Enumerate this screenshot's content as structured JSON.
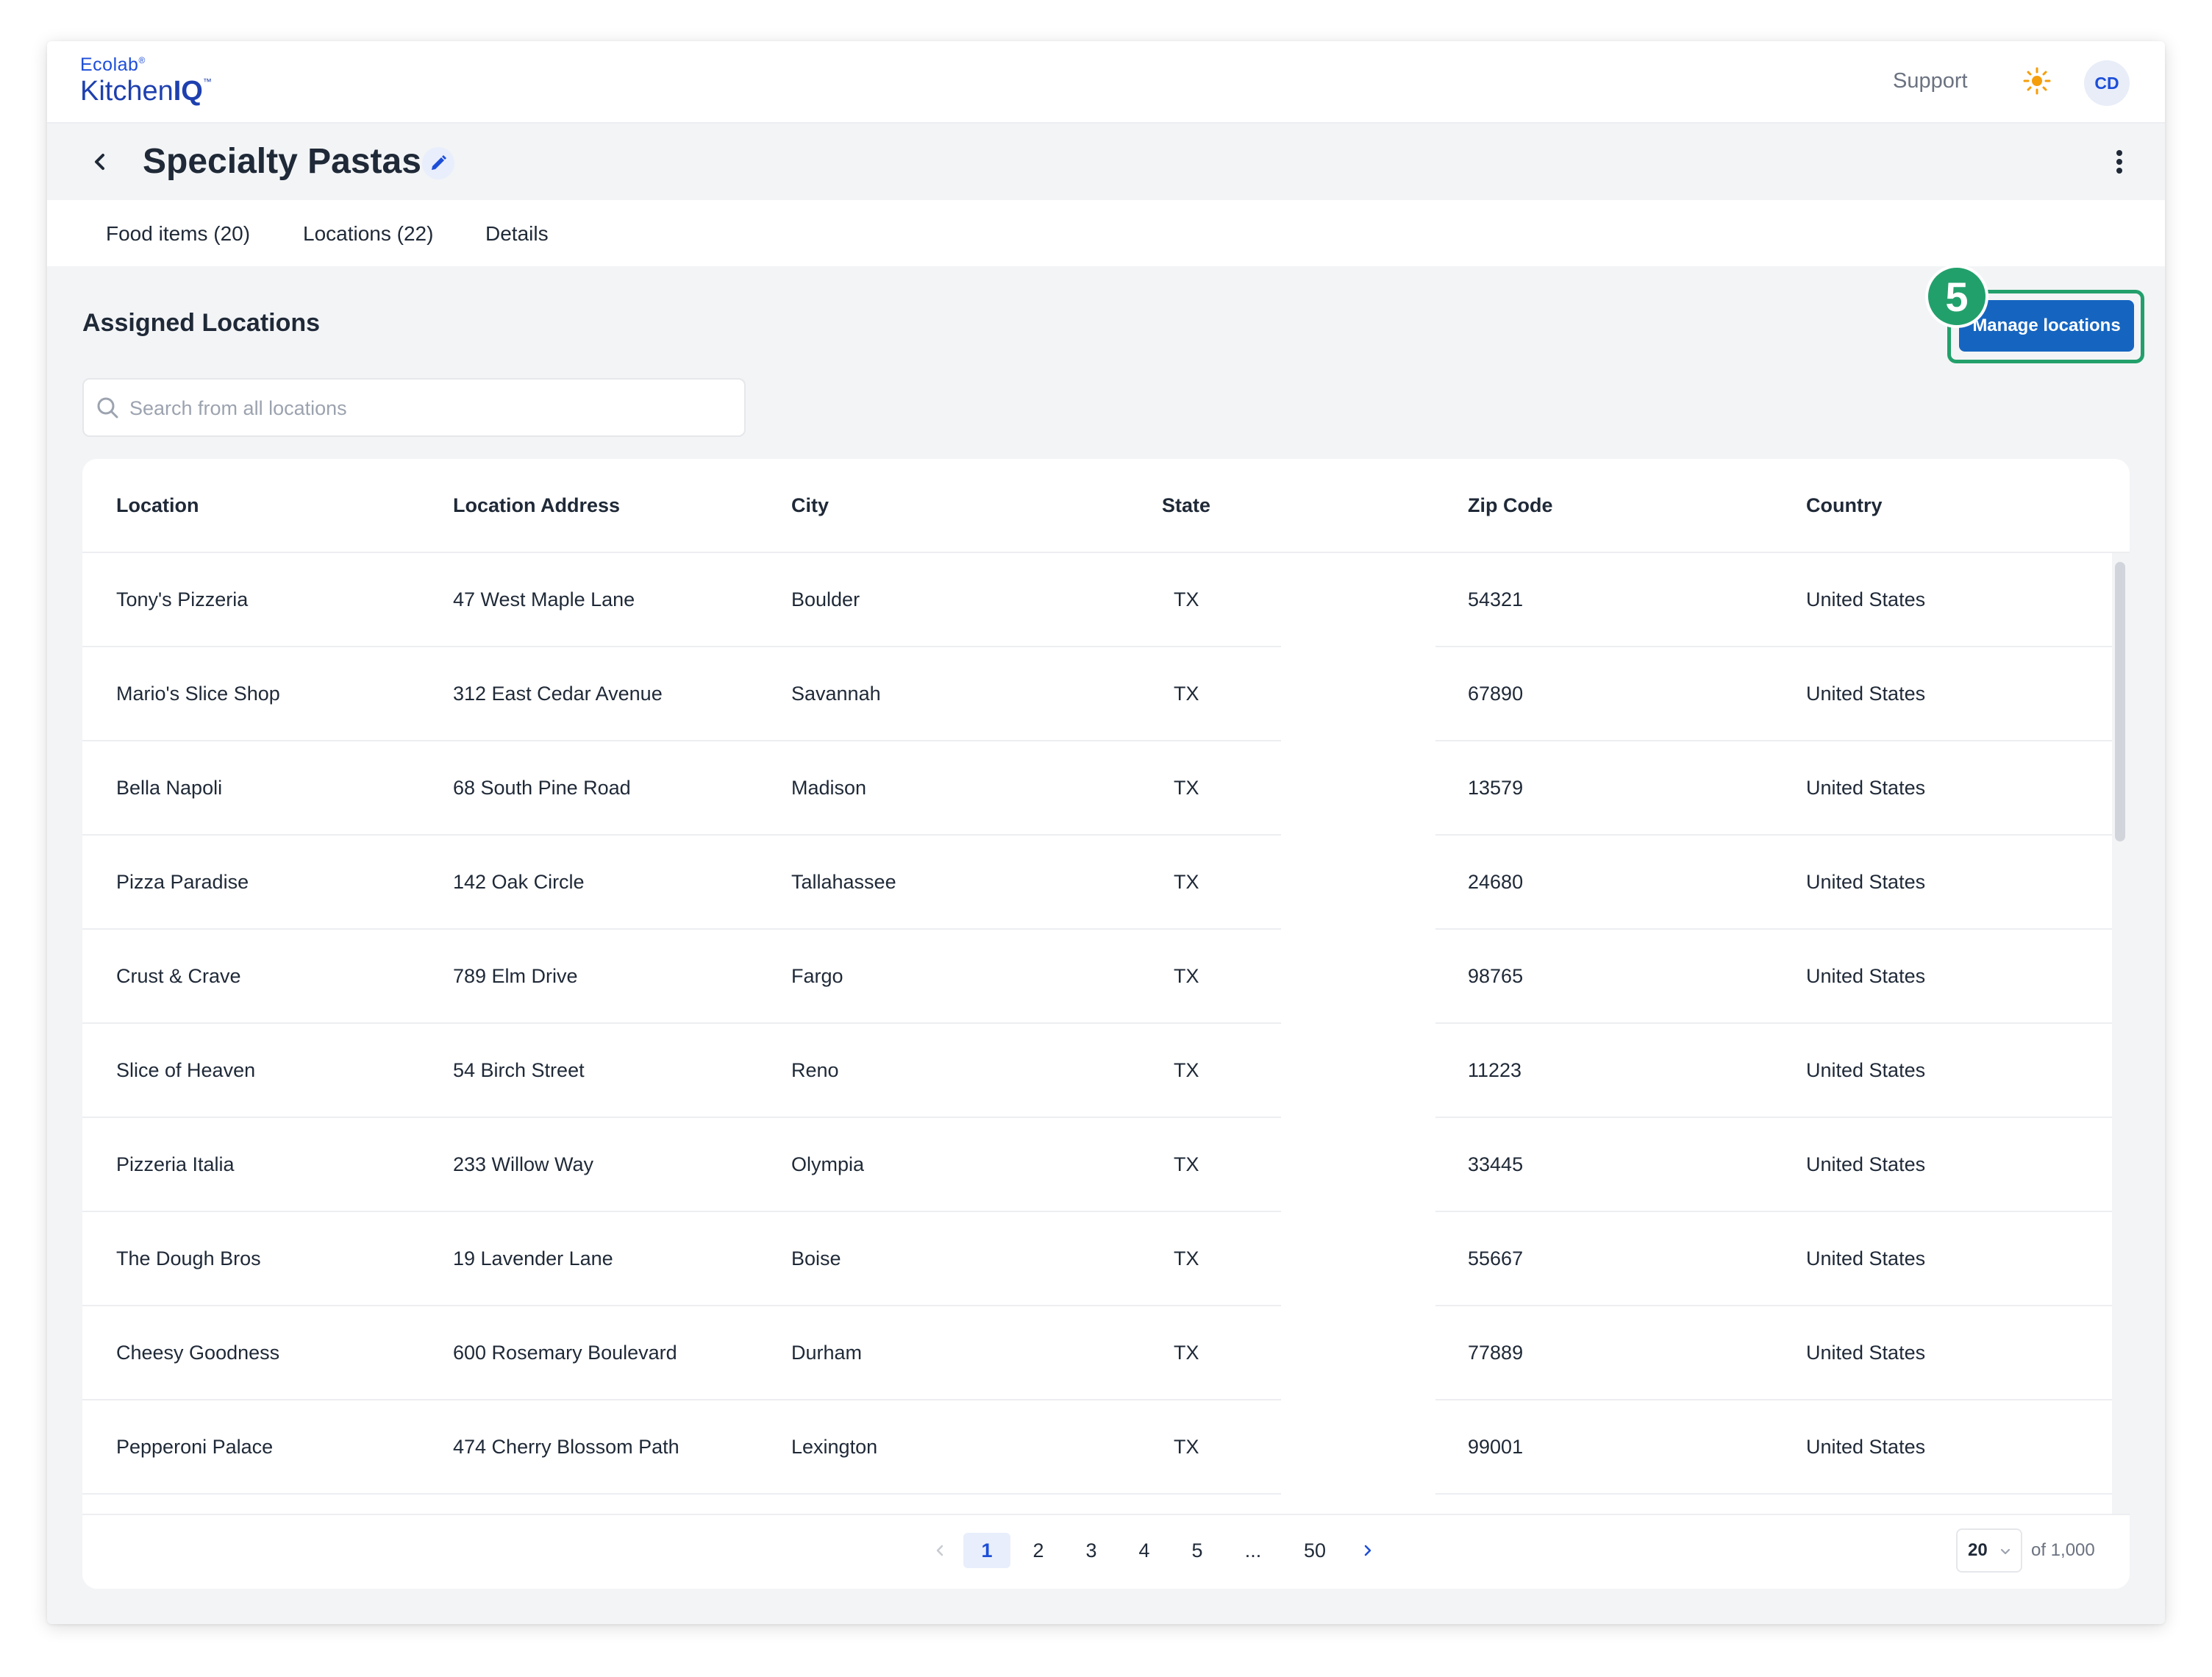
{
  "brand": {
    "line1": "Ecolab",
    "line1_mark": "®",
    "line2_a": "Kitchen",
    "line2_b": "IQ",
    "line2_mark": "™"
  },
  "header": {
    "support_label": "Support",
    "theme_icon": "sun-icon",
    "avatar_initials": "CD"
  },
  "page": {
    "title": "Specialty Pastas"
  },
  "tabs": [
    {
      "label": "Food items (20)"
    },
    {
      "label": "Locations (22)"
    },
    {
      "label": "Details"
    }
  ],
  "section": {
    "title": "Assigned Locations",
    "manage_label": "Manage locations",
    "step_number": "5"
  },
  "search": {
    "placeholder": "Search from all locations",
    "value": ""
  },
  "table": {
    "columns": [
      "Location",
      "Location Address",
      "City",
      "State",
      "Zip Code",
      "Country"
    ],
    "rows": [
      [
        "Tony's Pizzeria",
        "47 West Maple Lane",
        "Boulder",
        "TX",
        "54321",
        "United States"
      ],
      [
        "Mario's Slice Shop",
        "312 East Cedar Avenue",
        "Savannah",
        "TX",
        "67890",
        "United States"
      ],
      [
        "Bella Napoli",
        "68 South Pine Road",
        "Madison",
        "TX",
        "13579",
        "United States"
      ],
      [
        "Pizza Paradise",
        "142 Oak Circle",
        "Tallahassee",
        "TX",
        "24680",
        "United States"
      ],
      [
        "Crust & Crave",
        "789 Elm Drive",
        "Fargo",
        "TX",
        "98765",
        "United States"
      ],
      [
        "Slice of Heaven",
        "54 Birch Street",
        "Reno",
        "TX",
        "11223",
        "United States"
      ],
      [
        "Pizzeria Italia",
        "233 Willow Way",
        "Olympia",
        "TX",
        "33445",
        "United States"
      ],
      [
        "The Dough Bros",
        "19 Lavender Lane",
        "Boise",
        "TX",
        "55667",
        "United States"
      ],
      [
        "Cheesy Goodness",
        "600 Rosemary Boulevard",
        "Durham",
        "TX",
        "77889",
        "United States"
      ],
      [
        "Pepperoni Palace",
        "474 Cherry Blossom Path",
        "Lexington",
        "TX",
        "99001",
        "United States"
      ]
    ]
  },
  "pagination": {
    "pages": [
      "1",
      "2",
      "3",
      "4",
      "5",
      "...",
      "50"
    ],
    "current": "1",
    "page_size": "20",
    "total_label": "of 1,000"
  },
  "colors": {
    "accent": "#1565c0",
    "highlight": "#22a06b",
    "background": "#f3f4f6"
  }
}
